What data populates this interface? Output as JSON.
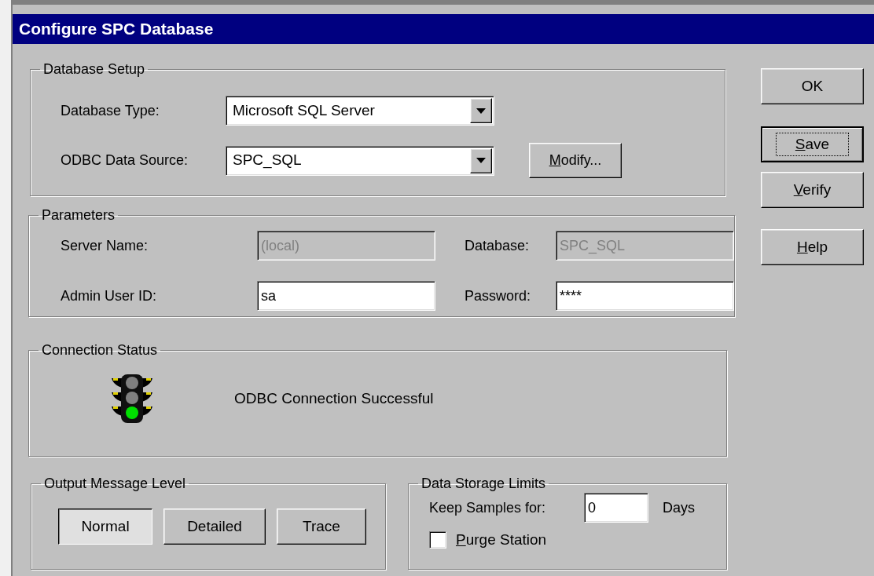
{
  "window": {
    "title": "Configure SPC Database"
  },
  "database_setup": {
    "title": "Database Setup",
    "fields": [
      {
        "label": "Database Type:",
        "value": "Microsoft SQL Server"
      },
      {
        "label": "ODBC Data Source:",
        "value": "SPC_SQL"
      }
    ],
    "modify_button": {
      "label": "Modify...",
      "underlined_first": true
    }
  },
  "parameters": {
    "title": "Parameters",
    "fields": [
      {
        "label": "Server Name:",
        "value": "(local)",
        "disabled": true
      },
      {
        "label": "Database:",
        "value": "SPC_SQL",
        "disabled": true
      },
      {
        "label": "Admin User ID:",
        "value": "sa",
        "disabled": false
      },
      {
        "label": "Password:",
        "value": "****",
        "disabled": false
      }
    ]
  },
  "connection_status": {
    "title": "Connection Status",
    "connected": true,
    "message": "ODBC Connection Successful"
  },
  "output_message_level": {
    "title": "Output Message Level",
    "options": [
      {
        "label": "Normal",
        "selected": true
      },
      {
        "label": "Detailed",
        "selected": false
      },
      {
        "label": "Trace",
        "selected": false
      }
    ]
  },
  "data_storage_limits": {
    "title": "Data Storage Limits",
    "keep_label": "Keep Samples for:",
    "keep_value": "0",
    "unit": "Days",
    "purge": {
      "label": "Purge Station",
      "underlined_first": true,
      "checked": false
    }
  },
  "buttons": [
    {
      "label": "OK",
      "underlined_first": false,
      "default": false
    },
    {
      "label": "Save",
      "underlined_first": true,
      "default": true
    },
    {
      "label": "Verify",
      "underlined_first": true,
      "default": false
    },
    {
      "label": "Help",
      "underlined_first": true,
      "default": false
    }
  ]
}
